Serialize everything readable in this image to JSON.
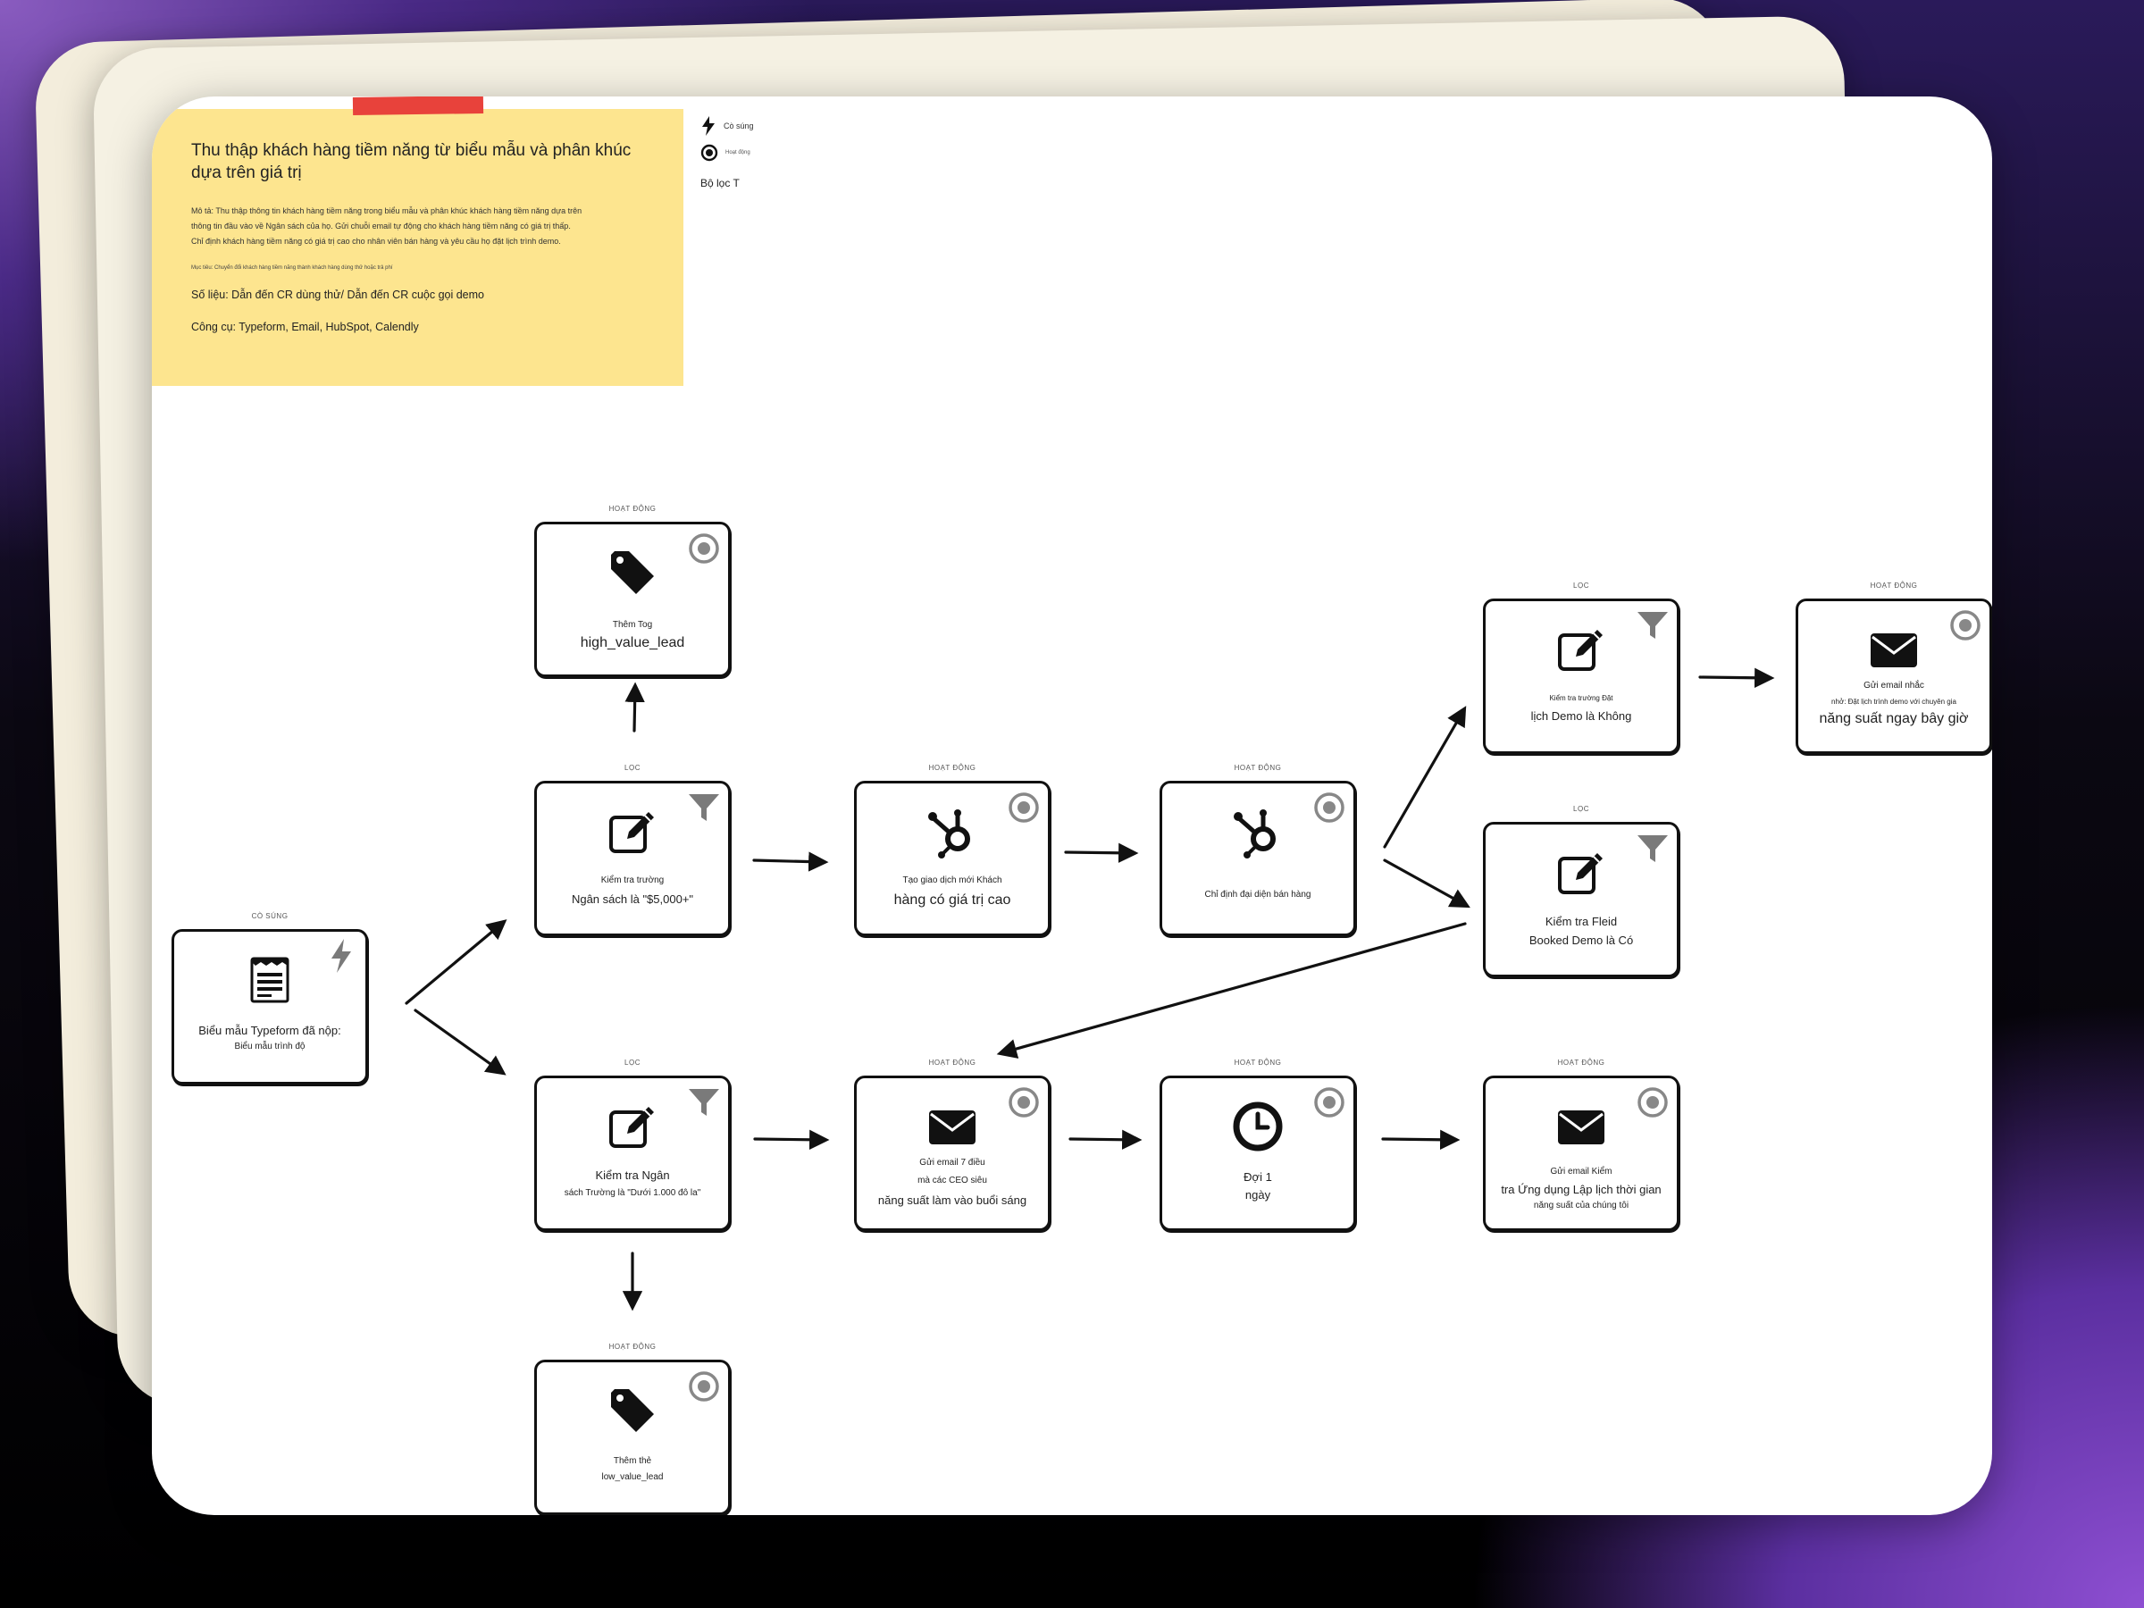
{
  "note": {
    "title": "Thu thập khách hàng tiềm năng từ biểu mẫu và phân khúc dựa trên giá trị",
    "description": "Mô tả: Thu thập thông tin khách hàng tiềm năng trong biểu mẫu và phân khúc khách hàng tiềm năng dựa trên thông tin đầu vào về Ngân sách của họ. Gửi chuỗi email tự động cho khách hàng tiềm năng có giá trị thấp. Chỉ định khách hàng tiềm năng có giá trị cao cho nhân viên bán hàng và yêu cầu họ đặt lịch trình demo.",
    "goal": "Mục tiêu: Chuyển đổi khách hàng tiềm năng thành khách hàng dùng thử hoặc trả phí",
    "metrics": "Số liệu: Dẫn đến CR dùng thử/ Dẫn đến CR cuộc gọi demo",
    "tools": "Công cụ: Typeform, Email, HubSpot, Calendly"
  },
  "legend": {
    "trigger": "Cò súng",
    "action": "Hoạt động",
    "filter": "Bộ lọc T"
  },
  "nodes": {
    "trigger": {
      "tag": "CÒ SÚNG",
      "line1": "Biểu mẫu Typeform đã nộp:",
      "line2": "Biểu mẫu trình độ",
      "icon": "form-icon",
      "corner": "bolt-icon"
    },
    "filter_high": {
      "tag": "LỌC",
      "line1": "Kiểm tra trường",
      "line2": "Ngân sách là \"$5,000+\"",
      "icon": "edit-icon",
      "corner": "filter-icon"
    },
    "tag_high": {
      "tag": "HOẠT ĐỘNG",
      "line1": "Thêm Tog",
      "line2": "high_value_lead",
      "icon": "tag-icon",
      "corner": "target-icon"
    },
    "create_deal": {
      "tag": "HOẠT ĐỘNG",
      "line1": "Tạo giao dịch mới Khách",
      "line2": "hàng có giá trị cao",
      "icon": "hubspot-icon",
      "corner": "target-icon"
    },
    "assign_rep": {
      "tag": "HOẠT ĐỘNG",
      "line1": "Chỉ định đại diện bán hàng",
      "icon": "hubspot-icon",
      "corner": "target-icon"
    },
    "filter_demo_no": {
      "tag": "LỌC",
      "line1": "Kiểm tra trường Đặt",
      "line2": "lịch Demo là Không",
      "icon": "edit-icon",
      "corner": "filter-icon"
    },
    "reminder_email": {
      "tag": "HOẠT ĐỘNG",
      "line1": "Gửi email nhắc",
      "line2": "nhở: Đặt lịch trình demo với chuyên gia",
      "line3": "năng suất ngay bây giờ",
      "icon": "mail-icon",
      "corner": "target-icon"
    },
    "filter_demo_yes": {
      "tag": "LỌC",
      "line1": "Kiểm tra Fleid",
      "line2": "Booked Demo là Có",
      "icon": "edit-icon",
      "corner": "filter-icon"
    },
    "filter_low": {
      "tag": "LỌC",
      "line1": "Kiểm tra Ngân",
      "line2": "sách Trường là \"Dưới 1.000 đô la\"",
      "icon": "edit-icon",
      "corner": "filter-icon"
    },
    "email_seven": {
      "tag": "HOẠT ĐỘNG",
      "line1": "Gửi email 7 điều",
      "line2": "mà các CEO siêu",
      "line3": "năng suất làm vào buổi sáng",
      "icon": "mail-icon",
      "corner": "target-icon"
    },
    "wait_day": {
      "tag": "HOẠT ĐỘNG",
      "line1": "Đợi 1",
      "line2": "ngày",
      "icon": "clock-icon",
      "corner": "target-icon"
    },
    "email_app": {
      "tag": "HOẠT ĐỘNG",
      "line1": "Gửi email Kiểm",
      "line2": "tra Ứng dụng Lập lịch thời gian",
      "line3": "năng suất của chúng tôi",
      "icon": "mail-icon",
      "corner": "target-icon"
    },
    "tag_low": {
      "tag": "HOẠT ĐỘNG",
      "line1": "Thêm thẻ",
      "line2": "low_value_lead",
      "icon": "tag-icon",
      "corner": "target-icon"
    }
  }
}
